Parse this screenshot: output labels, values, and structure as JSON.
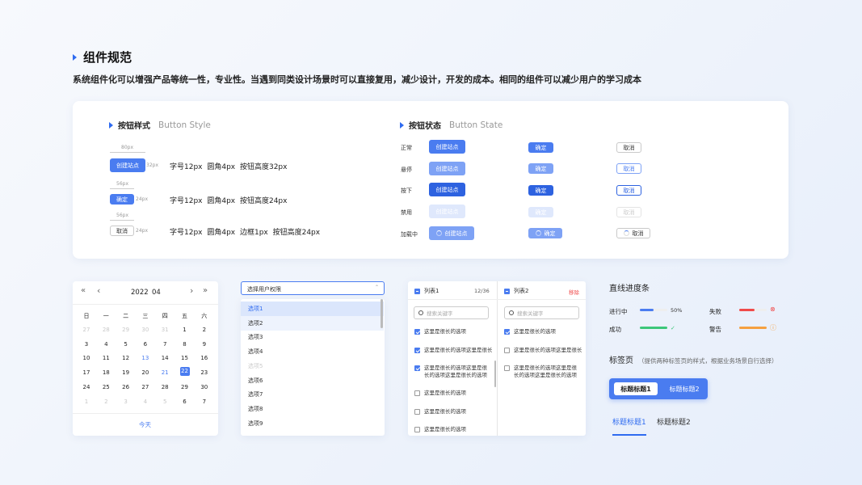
{
  "page": {
    "title": "组件规范",
    "subtitle": "系统组件化可以增强产品等统一性，专业性。当遇到同类设计场景时可以直接复用，减少设计，开发的成本。相同的组件可以减少用户的学习成本"
  },
  "button_style": {
    "title": "按钮样式",
    "title_en": "Button Style",
    "create_label": "创建站点",
    "confirm_label": "确定",
    "cancel_label": "取消",
    "dim_80": "80px",
    "dim_32": "32px",
    "dim_56a": "56px",
    "dim_24a": "24px",
    "dim_56b": "56px",
    "dim_24b": "24px",
    "spec1": "字号12px  圆角4px  按钮高度32px",
    "spec2": "字号12px  圆角4px  按钮高度24px",
    "spec3": "字号12px  圆角4px  边框1px  按钮高度24px"
  },
  "button_state": {
    "title": "按钮状态",
    "title_en": "Button State",
    "states": [
      "正常",
      "悬停",
      "按下",
      "禁用",
      "加载中"
    ],
    "create_label": "创建站点",
    "confirm_label": "确定",
    "cancel_label": "取消"
  },
  "calendar": {
    "year": "2022",
    "month": "04",
    "weekdays": [
      "日",
      "一",
      "二",
      "三",
      "四",
      "五",
      "六"
    ],
    "rows": [
      [
        "27",
        "28",
        "29",
        "30",
        "31",
        "1",
        "2"
      ],
      [
        "3",
        "4",
        "5",
        "6",
        "7",
        "8",
        "9"
      ],
      [
        "10",
        "11",
        "12",
        "13",
        "14",
        "15",
        "16"
      ],
      [
        "17",
        "18",
        "19",
        "20",
        "21",
        "22",
        "23"
      ],
      [
        "24",
        "25",
        "26",
        "27",
        "28",
        "29",
        "30"
      ],
      [
        "1",
        "2",
        "3",
        "4",
        "5",
        "6",
        "7"
      ]
    ],
    "selected": "22",
    "today_label": "今天",
    "nav_prev_year": "«",
    "nav_prev_month": "‹",
    "nav_next_month": "›",
    "nav_next_year": "»"
  },
  "select": {
    "placeholder": "选择用户权限",
    "options": [
      "选项1",
      "选项2",
      "选项3",
      "选项4",
      "选项5",
      "选项6",
      "选项7",
      "选项8",
      "选项9"
    ]
  },
  "transfer": {
    "left_title": "列表1",
    "left_count": "12/36",
    "right_title": "列表2",
    "right_action": "移除",
    "search_placeholder": "搜索关键字",
    "left_items": [
      "这里是很长的选项",
      "这里是很长的选项这里是很长",
      "这里是很长的选项这里是很长的选项这里是很长的选项",
      "这里是很长的选项",
      "这里是很长的选项",
      "这里是很长的选项"
    ],
    "right_items": [
      "这里是很长的选项",
      "这里是很长的选项这里是很长",
      "这里是很长的选项这里是很长的选项这里是很长的选项"
    ]
  },
  "progress": {
    "title": "直线进度条",
    "items": [
      {
        "label": "进行中",
        "value": 0.5,
        "text": "50%",
        "color": "#4a7cf0"
      },
      {
        "label": "失败",
        "value": 0.55,
        "text": "",
        "color": "#f04a4a"
      },
      {
        "label": "成功",
        "value": 1.0,
        "text": "",
        "color": "#3cc77a"
      },
      {
        "label": "警告",
        "value": 1.0,
        "text": "",
        "color": "#f5a040"
      }
    ]
  },
  "tabs": {
    "title": "标签页",
    "note": "（提供两种标签页的样式，根据业务场景自行选择）",
    "tab1": "标题标题1",
    "tab2": "标题标题2"
  },
  "colors": {
    "primary": "#4a7cf0",
    "hover": "#7ea2f5",
    "active": "#2d62e0",
    "disabled": "#dfe8fc",
    "danger": "#f04a4a"
  }
}
